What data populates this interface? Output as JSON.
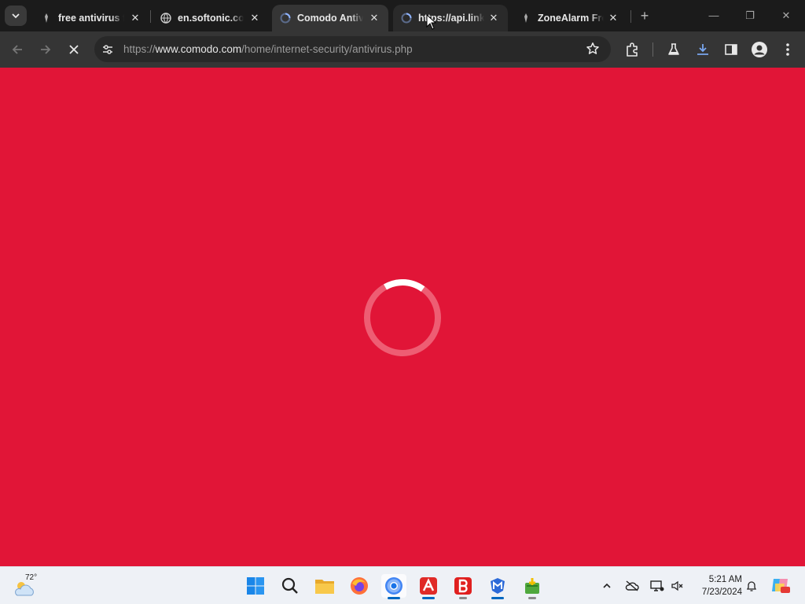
{
  "browser": {
    "tabs": [
      {
        "title": "free antivirus f",
        "favicon": "generic-site-icon",
        "active": false
      },
      {
        "title": "en.softonic.com",
        "favicon": "globe-icon",
        "active": false
      },
      {
        "title": "Comodo Antivi",
        "favicon": "loading-icon",
        "active": true
      },
      {
        "title": "https://api.link",
        "favicon": "loading-icon",
        "active": false
      },
      {
        "title": "ZoneAlarm Fre",
        "favicon": "generic-site-icon",
        "active": false
      }
    ],
    "close_glyph": "✕",
    "new_tab_glyph": "+",
    "window_controls": {
      "minimize": "—",
      "restore": "❐",
      "close": "✕"
    }
  },
  "address_bar": {
    "scheme": "https://",
    "host": "www.comodo.com",
    "path": "/home/internet-security/antivirus.php"
  },
  "page": {
    "background_color": "#e11537",
    "state": "loading"
  },
  "taskbar": {
    "weather": {
      "temp": "72°",
      "icon": "partly-cloudy-icon"
    },
    "apps": [
      "windows-start-icon",
      "search-icon",
      "file-explorer-icon",
      "firefox-icon",
      "chrome-icon",
      "avira-icon",
      "bitdefender-icon",
      "malwarebytes-icon",
      "installer-icon"
    ],
    "clock": {
      "time": "5:21 AM",
      "date": "7/23/2024"
    }
  }
}
